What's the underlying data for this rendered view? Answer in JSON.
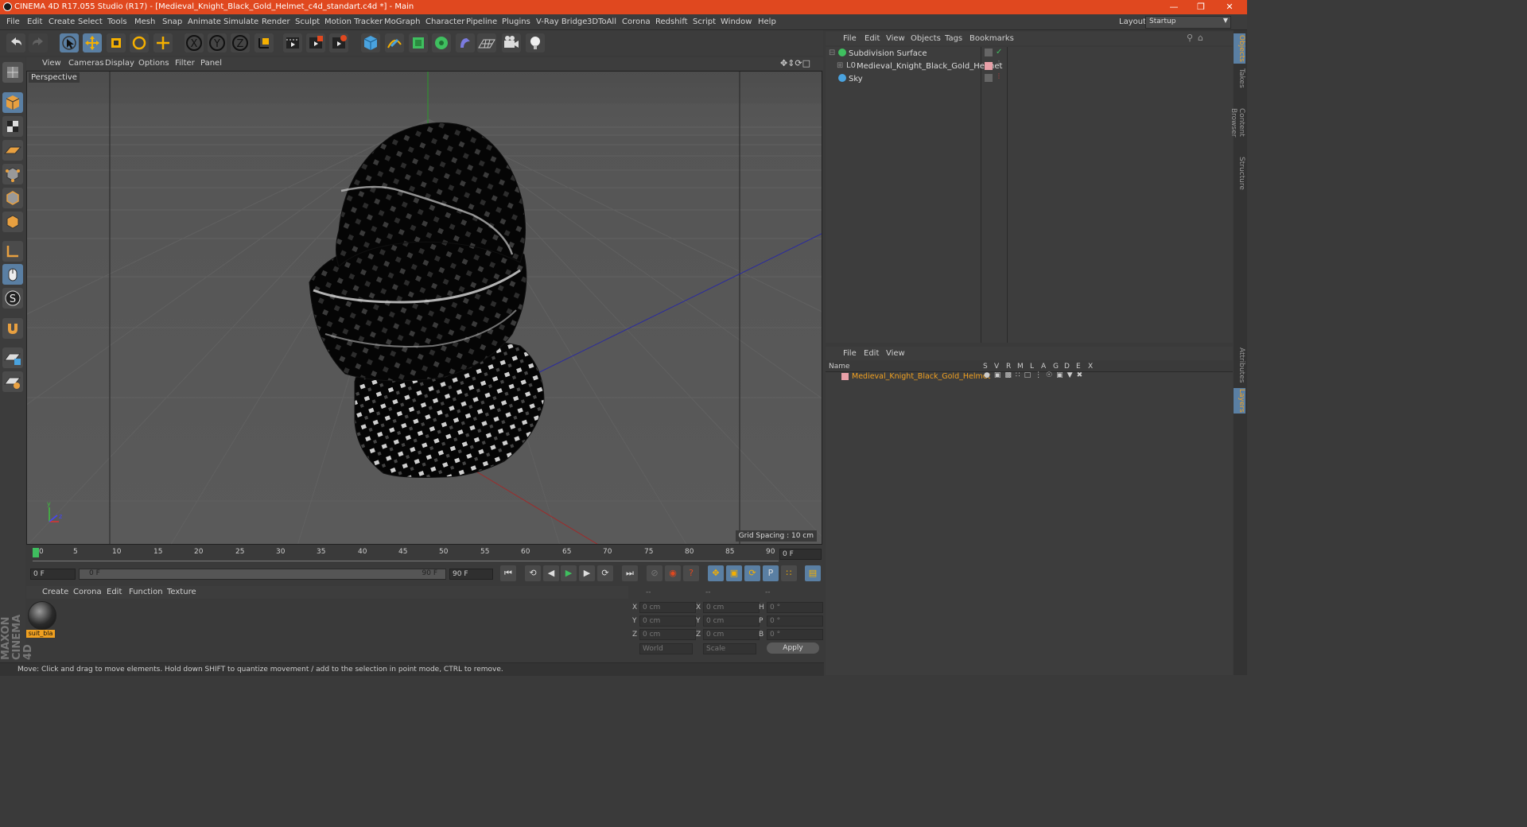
{
  "window": {
    "title": "CINEMA 4D R17.055 Studio (R17) - [Medieval_Knight_Black_Gold_Helmet_c4d_standart.c4d *] - Main"
  },
  "menubar": {
    "items": [
      "File",
      "Edit",
      "Create",
      "Select",
      "Tools",
      "Mesh",
      "Snap",
      "Animate",
      "Simulate",
      "Render",
      "Sculpt",
      "Motion Tracker",
      "MoGraph",
      "Character",
      "Pipeline",
      "Plugins",
      "V-Ray Bridge",
      "3DToAll",
      "Corona",
      "Redshift",
      "Script",
      "Window",
      "Help"
    ],
    "layout_label": "Layout:",
    "layout_value": "Startup"
  },
  "viewport": {
    "menu": [
      "View",
      "Cameras",
      "Display",
      "Options",
      "Filter",
      "Panel"
    ],
    "label": "Perspective",
    "grid_spacing": "Grid Spacing : 10 cm"
  },
  "timeline": {
    "ticks": [
      "0",
      "5",
      "10",
      "15",
      "20",
      "25",
      "30",
      "35",
      "40",
      "45",
      "50",
      "55",
      "60",
      "65",
      "70",
      "75",
      "80",
      "85",
      "90"
    ],
    "current_frame": "0 F",
    "start_field": "0 F",
    "range_start": "0 F",
    "range_end": "90 F",
    "end_field": "90 F"
  },
  "material_manager": {
    "menu": [
      "Create",
      "Corona",
      "Edit",
      "Function",
      "Texture"
    ],
    "materials": [
      {
        "name": "suit_bla"
      }
    ]
  },
  "coordinates": {
    "headers": [
      "--",
      "--",
      "--"
    ],
    "rows": [
      {
        "a": "X",
        "av": "0 cm",
        "b": "X",
        "bv": "0 cm",
        "c": "H",
        "cv": "0 °"
      },
      {
        "a": "Y",
        "av": "0 cm",
        "b": "Y",
        "bv": "0 cm",
        "c": "P",
        "cv": "0 °"
      },
      {
        "a": "Z",
        "av": "0 cm",
        "b": "Z",
        "bv": "0 cm",
        "c": "B",
        "cv": "0 °"
      }
    ],
    "mode1": "World",
    "mode2": "Scale",
    "apply": "Apply"
  },
  "status": {
    "text": "Move: Click and drag to move elements. Hold down SHIFT to quantize movement / add to the selection in point mode, CTRL to remove."
  },
  "object_manager": {
    "menu": [
      "File",
      "Edit",
      "View",
      "Objects",
      "Tags",
      "Bookmarks"
    ],
    "objects": [
      {
        "name": "Subdivision Surface"
      },
      {
        "name": "Medieval_Knight_Black_Gold_Helmet"
      },
      {
        "name": "Sky"
      }
    ]
  },
  "layer_manager": {
    "menu": [
      "File",
      "Edit",
      "View"
    ],
    "columns": [
      "Name",
      "S",
      "V",
      "R",
      "M",
      "L",
      "A",
      "G",
      "D",
      "E",
      "X"
    ],
    "layers": [
      {
        "name": "Medieval_Knight_Black_Gold_Helmet",
        "color": "#e8a0a8"
      }
    ]
  },
  "side_tabs": [
    "Objects",
    "Takes",
    "Content Browser",
    "Structure",
    "Attributes",
    "Layers"
  ],
  "branding": {
    "logo_text": "MAXON CINEMA 4D"
  },
  "colors": {
    "titlebar": "#e0481f",
    "accent_orange": "#f0a020",
    "highlight_blue": "#5a7fa3"
  }
}
